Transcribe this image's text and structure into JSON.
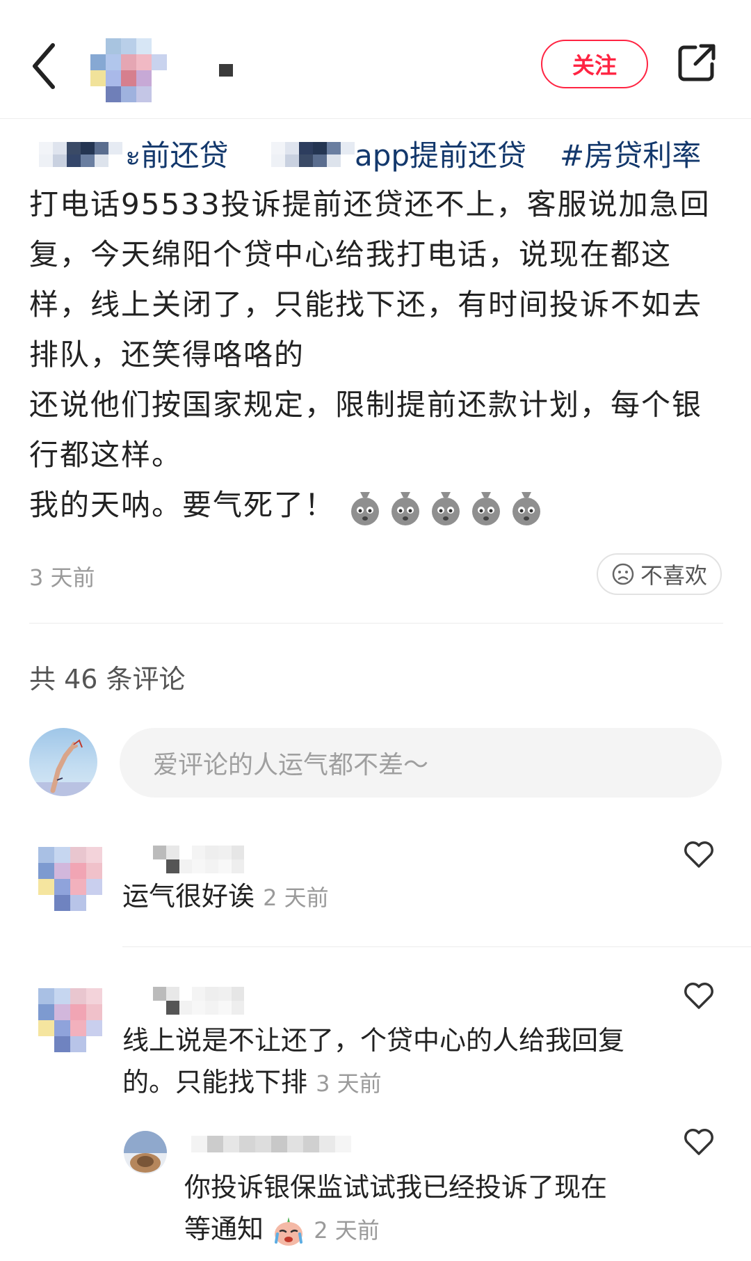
{
  "header": {
    "follow_label": "关注"
  },
  "tags": {
    "tag1_suffix": "ะ前还贷",
    "tag2_suffix": "app提前还贷",
    "tag3": "#房贷利率"
  },
  "post": {
    "para1": "打电话95533投诉提前还贷还不上，客服说加急回复，今天绵阳个贷中心给我打电话，说现在都这样，线上关闭了，只能找下还，有时间投诉不如去排队，还笑得咯咯的",
    "para2": "还说他们按国家规定，限制提前还款计划，每个银行都这样。",
    "para3": "我的天呐。要气死了！",
    "time": "3 天前",
    "dislike_label": "不喜欢"
  },
  "comments_header": {
    "count_text": "共 46 条评论",
    "input_placeholder": "爱评论的人运气都不差～"
  },
  "comments": [
    {
      "text": "运气很好诶",
      "time": "2 天前"
    },
    {
      "text_line1": "线上说是不让还了，个贷中心的人给我回复",
      "text_line2": "的。只能找下排",
      "time": "3 天前"
    },
    {
      "text_line1": "你投诉银保监试试我已经投诉了现在",
      "text_line2": "等通知",
      "time": "2 天前"
    }
  ],
  "icons": {
    "back": "chevron-left-icon",
    "share": "share-external-icon",
    "dislike": "sad-face-icon",
    "like": "heart-outline-icon",
    "emoji": "money-bag-emoji-icon"
  },
  "colors": {
    "accent": "#ff2442",
    "tag": "#13386c"
  }
}
